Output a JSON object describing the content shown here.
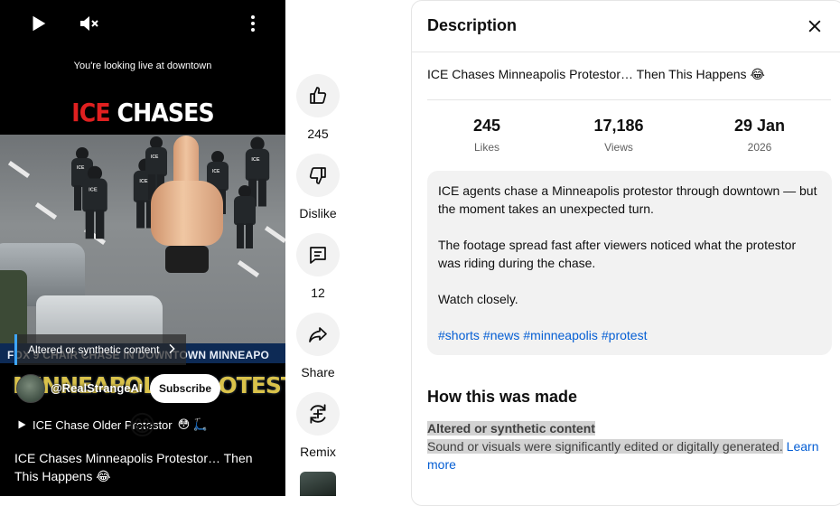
{
  "video": {
    "caption_top": "You're looking live at downtown",
    "headline_red": "ICE",
    "headline_white": "CHASES",
    "lower_strip": "FOX 9   CHAIR CHASE IN DOWNTOWN MINNEAPO",
    "overlay_title": "MINNEAPOLIS PROTESTOR",
    "altered_label": "Altered or synthetic content",
    "channel": "@RealStrangeAI",
    "subscribe_label": "Subscribe",
    "sound_label": "ICE Chase Older Protestor",
    "sound_emojis": "😳 🛴",
    "laugh_emoji": "😂",
    "title": "ICE Chases Minneapolis Protestor… Then This Happens 😂"
  },
  "actions": {
    "like_count": "245",
    "dislike_label": "Dislike",
    "comments_count": "12",
    "share_label": "Share",
    "remix_label": "Remix"
  },
  "panel": {
    "title": "Description",
    "video_title": "ICE Chases Minneapolis Protestor… Then This Happens 😂",
    "stats": {
      "likes_value": "245",
      "likes_label": "Likes",
      "views_value": "17,186",
      "views_label": "Views",
      "date_value": "29 Jan",
      "date_label": "2026"
    },
    "description": {
      "para1": "ICE agents chase a Minneapolis protestor through downtown — but the moment takes an unexpected turn.",
      "para2": "The footage spread fast after viewers noticed what the protestor was riding during the chase.",
      "para3": "Watch closely.",
      "hashtags": [
        "#shorts",
        "#news",
        "#minneapolis",
        "#protest"
      ]
    },
    "how_made": {
      "title": "How this was made",
      "heading": "Altered or synthetic content",
      "body": "Sound or visuals were significantly edited or digitally generated.",
      "learn_more": "Learn more"
    }
  },
  "icons": [
    "play-icon",
    "mute-icon",
    "more-vert-icon",
    "like-icon",
    "dislike-icon",
    "comment-icon",
    "share-icon",
    "remix-icon",
    "close-icon",
    "chevron-right-icon"
  ]
}
